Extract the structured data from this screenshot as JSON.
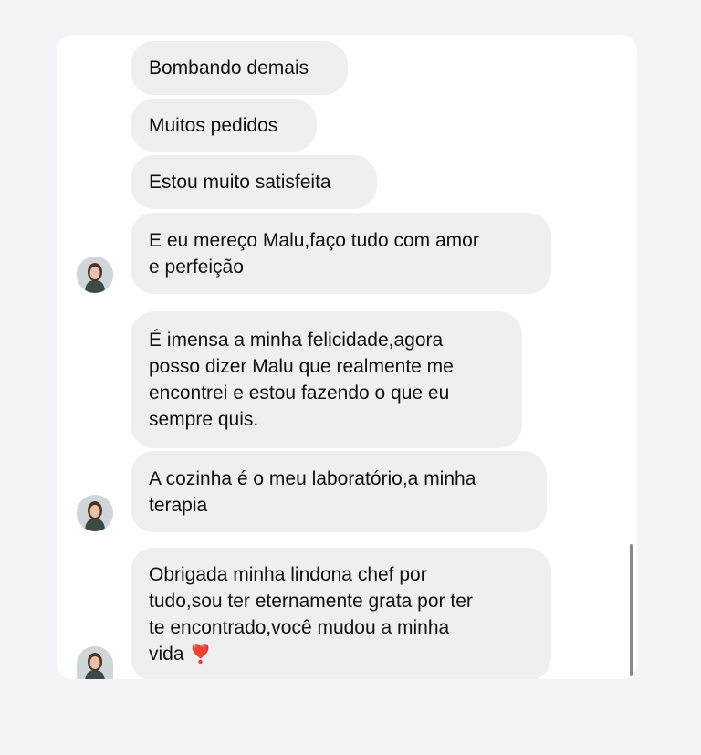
{
  "messages": [
    {
      "text": "Bombando demais"
    },
    {
      "text": "Muitos pedidos"
    },
    {
      "text": "Estou muito satisfeita"
    },
    {
      "text": "E eu mereço Malu,faço tudo com amor\ne perfeição"
    },
    {
      "text": "É imensa a minha felicidade,agora\nposso dizer Malu que realmente me\nencontrei e estou fazendo o que eu\nsempre quis."
    },
    {
      "text": "A cozinha é o meu laboratório,a minha\nterapia"
    },
    {
      "text": "Obrigada minha lindona chef por\ntudo,sou ter eternamente grata por ter\nte encontrado,você mudou a minha\nvida",
      "emoji": "❣️"
    }
  ],
  "avatar": {
    "icon": "user-photo-icon"
  },
  "colors": {
    "bubble": "#efefef",
    "background": "#f4f4f7",
    "card": "#ffffff"
  }
}
